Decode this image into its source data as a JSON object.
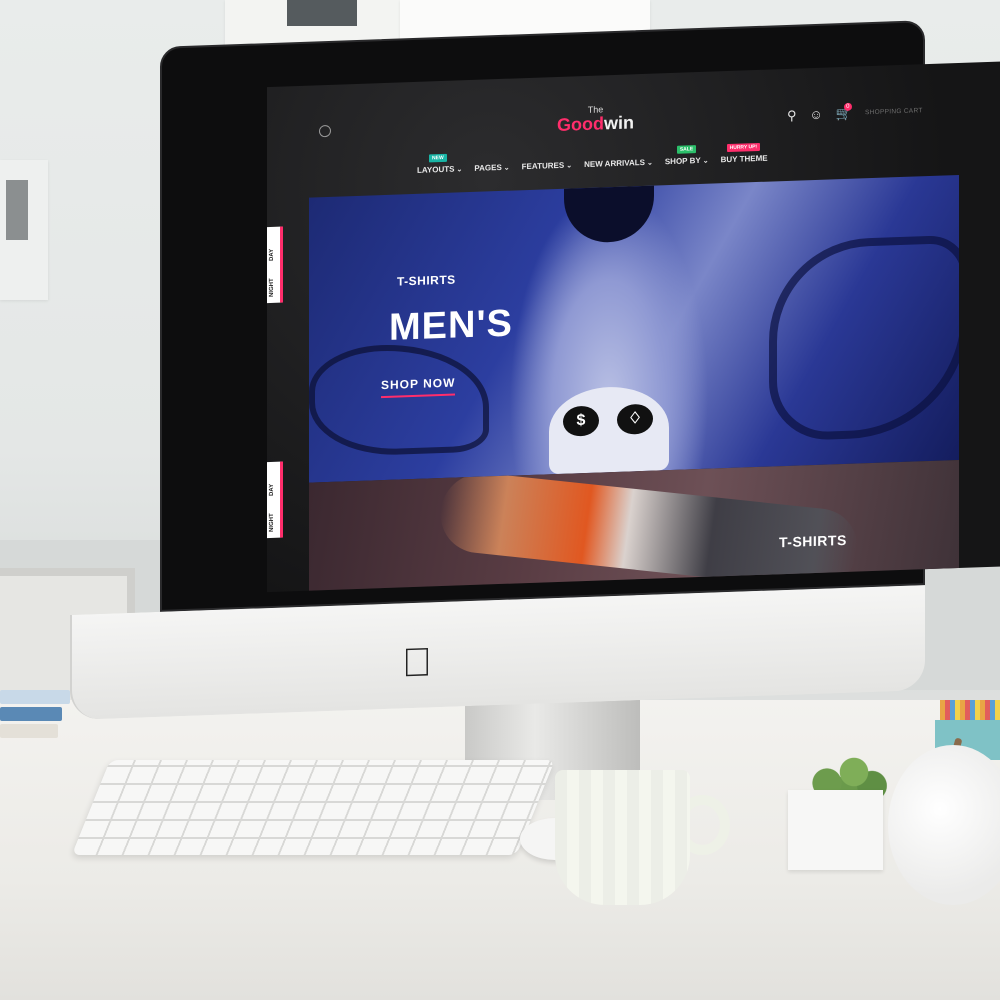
{
  "site": {
    "logo": {
      "prefix": "The",
      "name_accent": "Good",
      "name_rest": "win"
    },
    "header": {
      "icons": [
        "search-icon",
        "user-icon",
        "cart-icon"
      ],
      "cart_count": "0",
      "cart_label": "SHOPPING CART"
    },
    "nav": [
      {
        "label": "LAYOUTS",
        "badge": "NEW",
        "badge_color": "#19b5a6"
      },
      {
        "label": "PAGES",
        "badge": "",
        "badge_color": ""
      },
      {
        "label": "FEATURES",
        "badge": "",
        "badge_color": ""
      },
      {
        "label": "NEW ARRIVALS",
        "badge": "",
        "badge_color": ""
      },
      {
        "label": "SHOP BY",
        "badge": "SALE",
        "badge_color": "#2bbf6a"
      },
      {
        "label": "BUY THEME",
        "badge": "HURRY UP!",
        "badge_color": "#ff2d6b"
      }
    ],
    "hero_primary": {
      "tag": "T-SHIRTS",
      "title": "MEN'S",
      "cta": "SHOP NOW"
    },
    "hero_secondary": {
      "tag": "T-SHIRTS"
    },
    "theme_toggle": {
      "night": "NIGHT",
      "day": "DAY"
    },
    "accent_color": "#ff2d6b"
  }
}
